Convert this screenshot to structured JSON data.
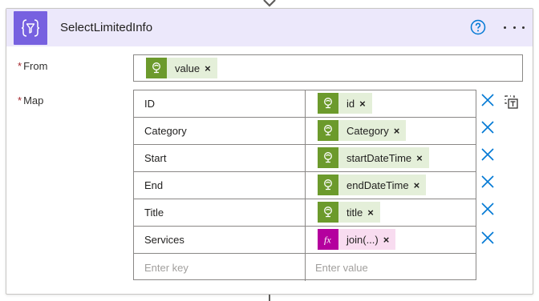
{
  "header": {
    "title": "SelectLimitedInfo",
    "icon": "select-action-icon",
    "help_icon": "help-circle-icon",
    "more_icon": "more-options-icon",
    "accent_color": "#7761e0",
    "background_color": "#ece8fb"
  },
  "from": {
    "required_mark": "*",
    "label": "From",
    "token": {
      "label": "value",
      "icon": "dynamic-content-icon",
      "remove": "×"
    }
  },
  "map": {
    "required_mark": "*",
    "label": "Map",
    "switch_mode_icon": "switch-to-text-mode-icon",
    "rows": [
      {
        "key": "ID",
        "value": "id",
        "kind": "dynamic"
      },
      {
        "key": "Category",
        "value": "Category",
        "kind": "dynamic"
      },
      {
        "key": "Start",
        "value": "startDateTime",
        "kind": "dynamic"
      },
      {
        "key": "End",
        "value": "endDateTime",
        "kind": "dynamic"
      },
      {
        "key": "Title",
        "value": "title",
        "kind": "dynamic"
      },
      {
        "key": "Services",
        "value": "join(...)",
        "kind": "expression"
      }
    ],
    "token_remove": "×",
    "key_placeholder": "Enter key",
    "value_placeholder": "Enter value",
    "dynamic_color": "#6c9a2c",
    "expression_color": "#b4009e",
    "delete_color": "#0078d4"
  }
}
